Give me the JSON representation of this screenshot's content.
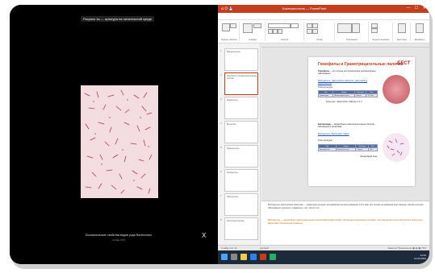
{
  "viewer": {
    "top_label": "Рисунок 1a — культура на питательной среде",
    "caption": "Биохимические свойства видов рода Bacteroides",
    "subcaption": "Слайд 3/14",
    "close_glyph": "X"
  },
  "app": {
    "title": "Бактериология — PowerPoint",
    "quick_access": "⎌ ⟳ 💾",
    "window_controls": "— ☐ ✕",
    "tabs": [
      "Файл",
      "Главная",
      "Вставка",
      "Конструктор",
      "Переходы",
      "Анимация",
      "Слайд-шоу",
      "Рецензирование",
      "Вид",
      "Справка",
      "Формат фигуры"
    ],
    "active_tab_index": 1
  },
  "ribbon_groups": [
    "Буфер обмена",
    "Слайды",
    "Шрифт",
    "Абзац",
    "Рисование",
    "Редактирование",
    "Диктовка",
    "Дизайнер"
  ],
  "thumbs": [
    {
      "num": "1",
      "title": "Бактериология"
    },
    {
      "num": "2",
      "title": "Гемофилы и Грамотрицательные палочки"
    },
    {
      "num": "3",
      "title": "Бордетеллы"
    },
    {
      "num": "4",
      "title": "Бруцеллы"
    },
    {
      "num": "5",
      "title": "Франциселлы"
    },
    {
      "num": "6",
      "title": "Легионеллы"
    },
    {
      "num": "7",
      "title": "Пастереллы"
    },
    {
      "num": "8",
      "title": "Пептострептококки"
    }
  ],
  "slide": {
    "title": "Гемофилы и Грамотрицательные палочки",
    "logo": "БЕСТ",
    "block1_heading": "Гемофилы",
    "block1_text": "— это острые или хронические респираторные заболевания",
    "block1_cause": "Возбудитель: Haemophilus influenzae, Haemophilus parainfluenzae",
    "block1_sub": "Типы культуры:",
    "table1_head": [
      "Тип",
      "Среда",
      "Колонии",
      "Рост"
    ],
    "table1_row": [
      "Грамотриц.",
      "Шоколадный агар",
      "Серые",
      "24–48 ч"
    ],
    "block1_note": "Культура / гемоглобин / Фактор X и V",
    "block2_heading": "Бактероиды",
    "block2_text": "— анаэробные грамотрицательные палочки, обитающие в кишечнике",
    "block2_cause": "Возбудитель: Bacteroides fragilis",
    "block2_sub": "Типы культуры:",
    "table2_head": [
      "Тип",
      "Среда",
      "Колонии",
      "Рост"
    ],
    "table2_row": [
      "Анаэробные",
      "Кровяной агар",
      "Серые",
      "48 ч"
    ],
    "block2_note": "Анаэробный бокс"
  },
  "notes": {
    "p1": "Возбудитель Haemophilus influenzae — грамотрицательная, неподвижная палочка размером 1×0,3 мкм, при посеве на кровяной агар образует мелкие колонии. Заболевания: менингит, пневмония, отит, эпиглоттит.",
    "p2": "Возбудитель — анаэробная грамотрицательная палочка Bacteroides fragilis, обитающая в кишечнике человека; часто выделяется при абсцессах и перитоните. Bacteroides chromosomal resistance."
  },
  "status": {
    "left": "Слайд 3 из 14",
    "language": "русский",
    "right": "Заметки   Примечания   ▣ ▤ ▦   74%"
  },
  "taskbar": {
    "time": "14:32",
    "date": "12.03.2024"
  },
  "colors": {
    "accent": "#c43e1c",
    "logo": "#b5202a",
    "table_header": "#4a6aa8"
  }
}
